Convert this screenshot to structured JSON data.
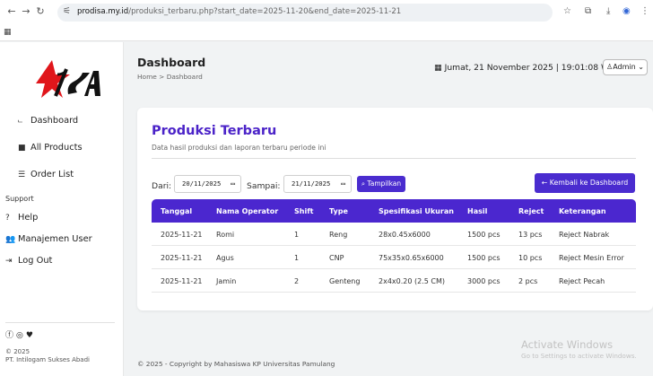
{
  "browser": {
    "url_host": "prodisa.my.id",
    "url_path": "/produksi_terbaru.php?start_date=2025-11-20&end_date=2025-11-21"
  },
  "sidebar": {
    "items": [
      {
        "icon": "⨽",
        "label": "Dashboard"
      },
      {
        "icon": "■",
        "label": "All Products"
      },
      {
        "icon": "☰",
        "label": "Order List"
      }
    ],
    "support_heading": "Support",
    "support_items": [
      {
        "icon": "?",
        "label": "Help"
      },
      {
        "icon": "👥",
        "label": "Manajemen User"
      },
      {
        "icon": "⇥",
        "label": "Log Out"
      }
    ],
    "copyright_year": "© 2025",
    "company": "PT. Intilogam Sukses Abadi"
  },
  "header": {
    "title": "Dashboard",
    "breadcrumb": "Home > Dashboard",
    "datetime": "Jumat, 21 November 2025 | 19:01:08 WIB",
    "admin_label": "Admin"
  },
  "card": {
    "title": "Produksi Terbaru",
    "subtitle": "Data hasil produksi dan laporan terbaru periode ini",
    "filter": {
      "from_label": "Dari:",
      "from_value": "20/11/2025",
      "to_label": "Sampai:",
      "to_value": "21/11/2025",
      "show_button": "Tampilkan",
      "back_button": "Kembali ke Dashboard"
    },
    "table": {
      "headers": [
        "Tanggal",
        "Nama Operator",
        "Shift",
        "Type",
        "Spesifikasi Ukuran",
        "Hasil",
        "Reject",
        "Keterangan"
      ],
      "rows": [
        [
          "2025-11-21",
          "Romi",
          "1",
          "Reng",
          "28x0.45x6000",
          "1500 pcs",
          "13 pcs",
          "Reject Nabrak"
        ],
        [
          "2025-11-21",
          "Agus",
          "1",
          "CNP",
          "75x35x0.65x6000",
          "1500 pcs",
          "10 pcs",
          "Reject Mesin Error"
        ],
        [
          "2025-11-21",
          "Jamin",
          "2",
          "Genteng",
          "2x4x0.20 (2.5 CM)",
          "3000 pcs",
          "2 pcs",
          "Reject Pecah"
        ]
      ]
    }
  },
  "footer": {
    "copyright": "© 2025 - Copyright by Mahasiswa KP Universitas Pamulang"
  },
  "watermark": {
    "line1": "Activate Windows",
    "line2": "Go to Settings to activate Windows."
  },
  "colors": {
    "accent": "#4b27cf",
    "logo_red": "#e0161b"
  }
}
